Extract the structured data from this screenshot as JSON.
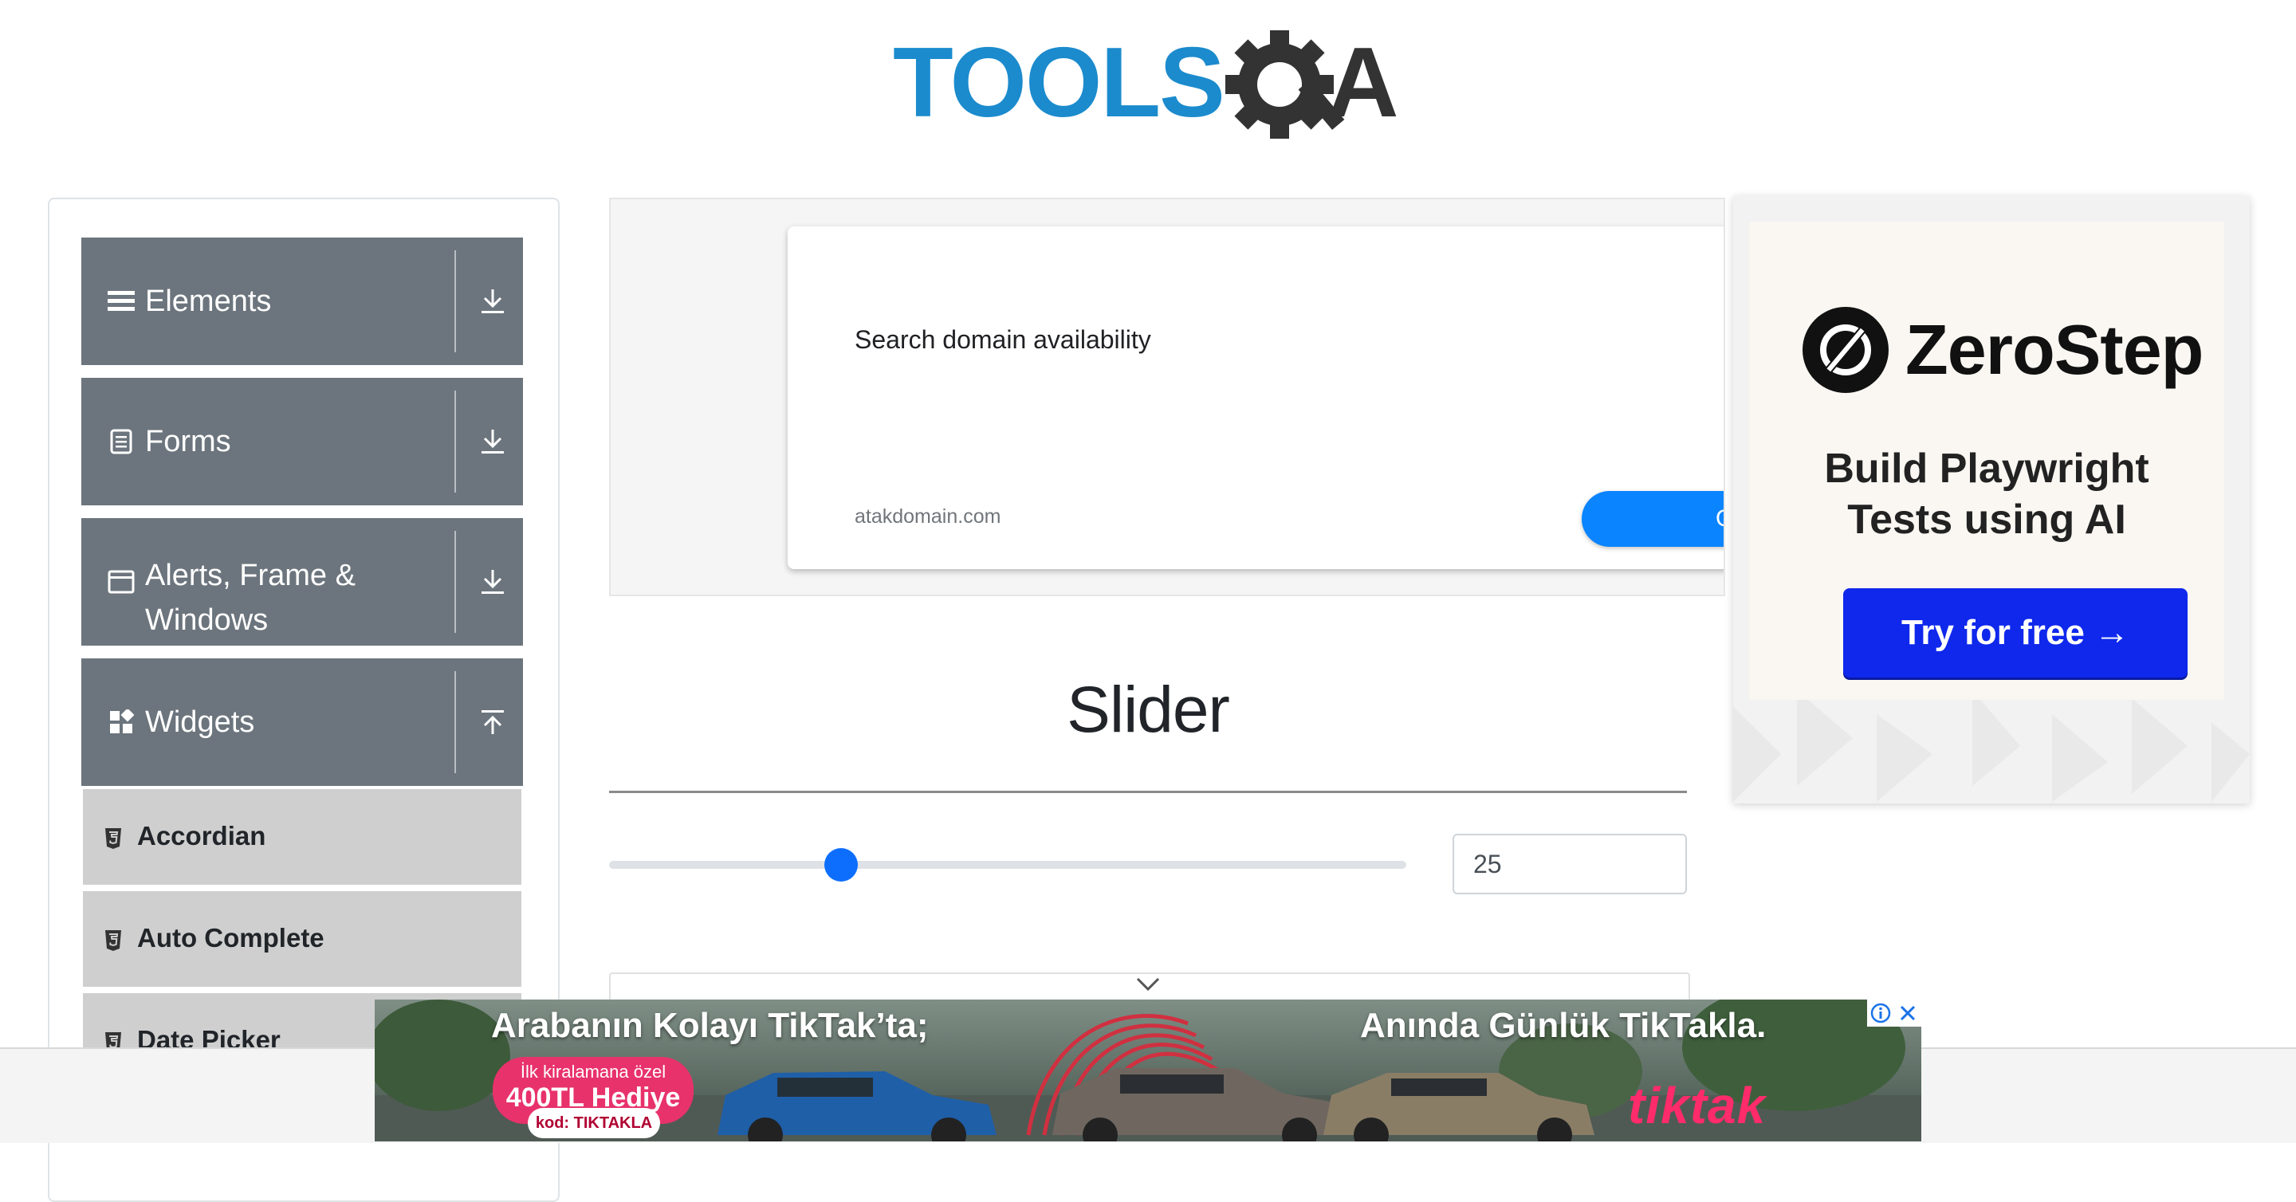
{
  "logo": {
    "brand": "TOOLSQA"
  },
  "sidebar": {
    "groups": [
      {
        "label": "Elements",
        "icon": "hamburger-icon",
        "toggle": "download-icon"
      },
      {
        "label": "Forms",
        "icon": "document-icon",
        "toggle": "download-icon"
      },
      {
        "label": "Alerts, Frame &",
        "label2": "Windows",
        "icon": "window-icon",
        "toggle": "download-icon"
      },
      {
        "label": "Widgets",
        "icon": "widgets-icon",
        "toggle": "upload-icon"
      }
    ],
    "items": [
      {
        "label": "Accordian",
        "icon": "html5-icon"
      },
      {
        "label": "Auto Complete",
        "icon": "html5-icon"
      },
      {
        "label": "Date Picker",
        "icon": "html5-icon"
      }
    ]
  },
  "top_ad": {
    "title": "Search domain availability",
    "domain": "atakdomain.com",
    "button": "Open"
  },
  "right_ad": {
    "brand": "ZeroStep",
    "tagline_line1": "Build Playwright",
    "tagline_line2": "Tests using AI",
    "cta": "Try for free →"
  },
  "main": {
    "title": "Slider",
    "slider": {
      "value": "25",
      "min": 0,
      "max": 100,
      "fraction": 0.25
    }
  },
  "bottom_ad": {
    "headline_left": "Arabanın Kolayı TikTak’ta;",
    "headline_right": "Anında Günlük TikTakla.",
    "badge_small": "İlk kiralamana özel",
    "badge_big": "400TL Hediye",
    "code": "kod: TIKTAKLA",
    "brand": "tiktak"
  },
  "colors": {
    "sidebar_header": "#6c757d",
    "sidebar_item": "#cfcfcf",
    "slider_thumb": "#0d6efd",
    "zerostep_button": "#0f28ec",
    "tiktak_pink": "#e8326b"
  }
}
